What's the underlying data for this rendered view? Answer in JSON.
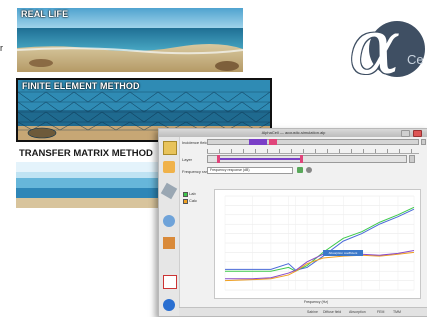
{
  "panels": {
    "real_life": "REAL LIFE",
    "fem": "FINITE ELEMENT METHOD",
    "tmm": "TRANSFER MATRIX METHOD",
    "side_fragment": "r"
  },
  "logo": {
    "glyph": "α",
    "suffix": "Ce",
    "color": "#3f4f63"
  },
  "window": {
    "title": "AlphaCell — acoustic-simulation.alp",
    "row1_label": "Incidence field",
    "row2_label": "Layer",
    "row3_label": "Frequency range",
    "dropdown_value": "Frequency response (dB)",
    "legend": [
      "Lab",
      "Calc"
    ],
    "popup_label": "Absorption coefficient",
    "xlabel": "Frequency (Hz)",
    "status_items": [
      "Sabine",
      "Diffuse field",
      "Absorption",
      "FEM",
      "TMM"
    ]
  },
  "colors": {
    "accent_purple": "#7a3fc7",
    "accent_pink": "#e0447a",
    "series_green": "#3cc84a",
    "series_blue": "#4a6ad8",
    "series_orange": "#f0a020",
    "series_purple": "#8a4ac8"
  },
  "chart_data": {
    "type": "line",
    "x": [
      50,
      100,
      160,
      250,
      300,
      400,
      600,
      1000,
      1600,
      2500,
      4000,
      6000
    ],
    "series": [
      {
        "values": [
          0.2,
          0.2,
          0.2,
          0.24,
          0.2,
          0.26,
          0.4,
          0.55,
          0.62,
          0.72,
          0.8,
          0.88
        ]
      },
      {
        "values": [
          0.22,
          0.22,
          0.22,
          0.28,
          0.21,
          0.24,
          0.36,
          0.52,
          0.6,
          0.7,
          0.78,
          0.86
        ]
      },
      {
        "values": [
          0.1,
          0.11,
          0.12,
          0.16,
          0.2,
          0.28,
          0.34,
          0.36,
          0.37,
          0.36,
          0.38,
          0.4
        ]
      },
      {
        "values": [
          0.12,
          0.12,
          0.13,
          0.18,
          0.21,
          0.3,
          0.38,
          0.4,
          0.38,
          0.37,
          0.39,
          0.42
        ]
      }
    ],
    "ylim": [
      0,
      1
    ],
    "grid": true
  }
}
